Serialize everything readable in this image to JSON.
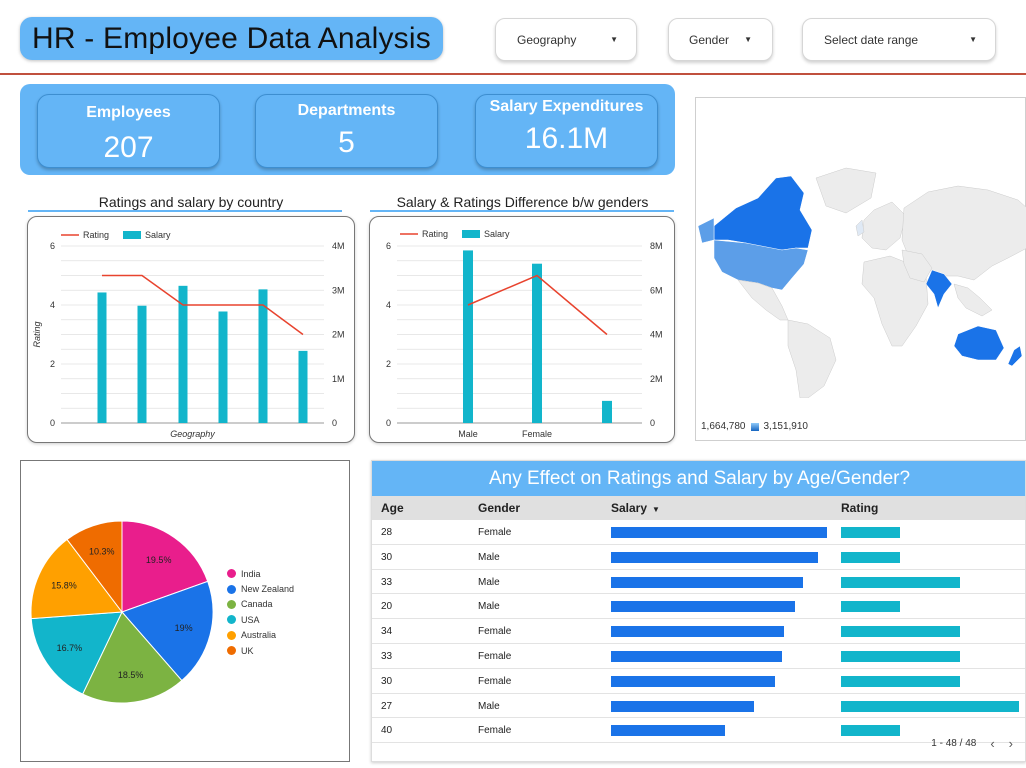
{
  "header": {
    "title": "HR - Employee Data Analysis",
    "filters": [
      {
        "label": "Geography"
      },
      {
        "label": "Gender"
      },
      {
        "label": "Select date range"
      }
    ]
  },
  "kpis": [
    {
      "label": "Employees",
      "value": "207"
    },
    {
      "label": "Departments",
      "value": "5"
    },
    {
      "label": "Salary Expenditures",
      "value": "16.1M"
    }
  ],
  "colors": {
    "accent": "#64b5f6",
    "rating_line": "#e8432e",
    "salary_bar": "#12b5cb",
    "table_salary": "#1a73e8"
  },
  "chart_data": [
    {
      "type": "bar",
      "title": "Ratings and salary by country",
      "legend": [
        "Rating",
        "Salary"
      ],
      "xlabel": "Geography",
      "ylabel": "Rating",
      "y_left_ticks": [
        "0",
        "2",
        "4",
        "6"
      ],
      "y_right_ticks": [
        "0",
        "1M",
        "2M",
        "3M",
        "4M"
      ],
      "ylim_left": [
        0,
        6
      ],
      "ylim_right": [
        0,
        4000000
      ],
      "categories": [
        "",
        "",
        "",
        "",
        "",
        ""
      ],
      "series": [
        {
          "name": "Salary",
          "axis": "right",
          "values": [
            2950000,
            2650000,
            3100000,
            2520000,
            3020000,
            1630000
          ]
        },
        {
          "name": "Rating",
          "axis": "left",
          "values": [
            5,
            5,
            4,
            4,
            4,
            3
          ]
        }
      ]
    },
    {
      "type": "bar",
      "title": "Salary & Ratings Difference b/w genders",
      "legend": [
        "Rating",
        "Salary"
      ],
      "y_left_ticks": [
        "0",
        "2",
        "4",
        "6"
      ],
      "y_right_ticks": [
        "0",
        "2M",
        "4M",
        "6M",
        "8M"
      ],
      "ylim_left": [
        0,
        6
      ],
      "ylim_right": [
        0,
        8000000
      ],
      "categories": [
        "Male",
        "Female",
        ""
      ],
      "series": [
        {
          "name": "Salary",
          "axis": "right",
          "values": [
            7800000,
            7200000,
            1000000
          ]
        },
        {
          "name": "Rating",
          "axis": "left",
          "values": [
            4,
            5,
            3
          ]
        }
      ]
    },
    {
      "type": "pie",
      "labels": [
        "India",
        "New Zealand",
        "Canada",
        "USA",
        "Australia",
        "UK"
      ],
      "values": [
        19.5,
        19,
        18.5,
        16.7,
        15.8,
        10.3
      ],
      "value_labels": [
        "19.5%",
        "19%",
        "18.5%",
        "16.7%",
        "15.8%",
        "10.3%"
      ],
      "colors": [
        "#e91e8c",
        "#1a73e8",
        "#7cb342",
        "#12b5cb",
        "#ffa000",
        "#ef6c00"
      ]
    }
  ],
  "map": {
    "legend_min": "1,664,780",
    "legend_max": "3,151,910"
  },
  "table": {
    "title": "Any Effect on Ratings and Salary by Age/Gender?",
    "columns": {
      "age": "Age",
      "gender": "Gender",
      "salary": "Salary",
      "rating": "Rating"
    },
    "sort_icon": "caret-down",
    "rows": [
      {
        "age": "28",
        "gender": "Female",
        "salary": 1.0,
        "rating": 0.33
      },
      {
        "age": "30",
        "gender": "Male",
        "salary": 0.96,
        "rating": 0.33
      },
      {
        "age": "33",
        "gender": "Male",
        "salary": 0.89,
        "rating": 0.67
      },
      {
        "age": "20",
        "gender": "Male",
        "salary": 0.85,
        "rating": 0.33
      },
      {
        "age": "34",
        "gender": "Female",
        "salary": 0.8,
        "rating": 0.67
      },
      {
        "age": "33",
        "gender": "Female",
        "salary": 0.79,
        "rating": 0.67
      },
      {
        "age": "30",
        "gender": "Female",
        "salary": 0.76,
        "rating": 0.67
      },
      {
        "age": "27",
        "gender": "Male",
        "salary": 0.66,
        "rating": 1.0
      },
      {
        "age": "40",
        "gender": "Female",
        "salary": 0.53,
        "rating": 0.33
      }
    ],
    "pager": "1 - 48 / 48"
  }
}
